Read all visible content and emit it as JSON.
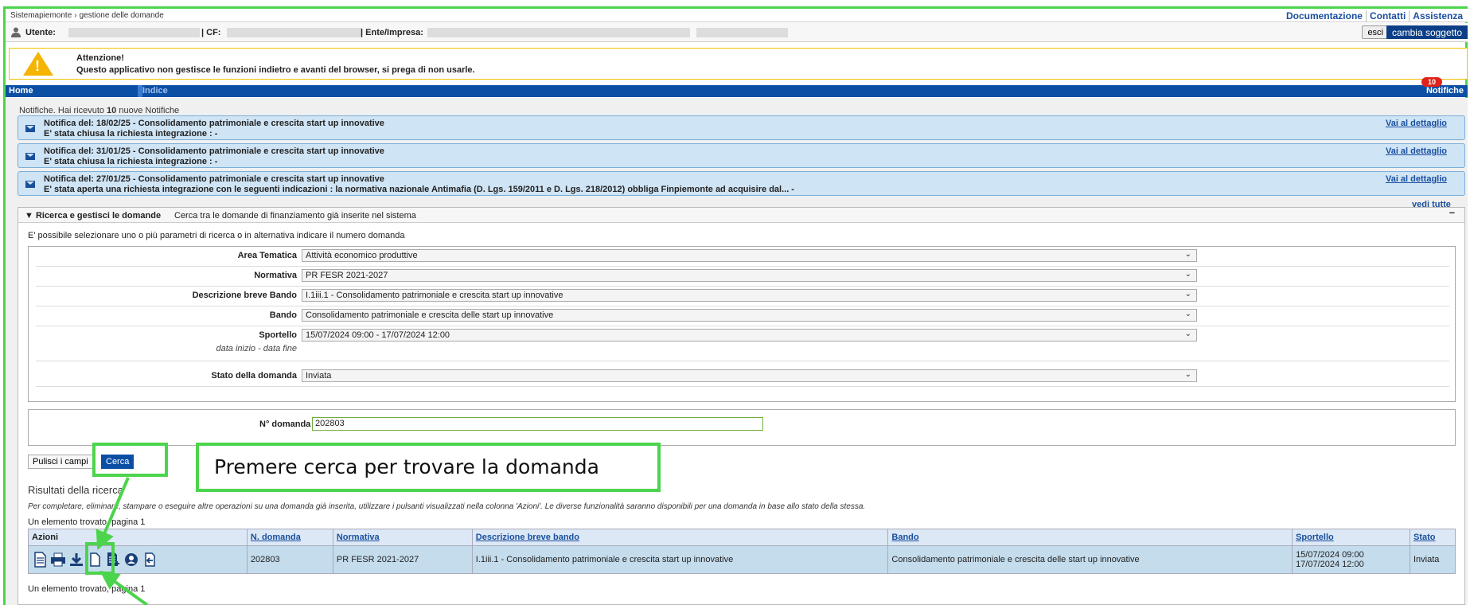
{
  "topbar": {
    "breadcrumb_root": "Sistemapiemonte",
    "breadcrumb_sep": "›",
    "breadcrumb_current": "gestione delle domande",
    "links": [
      "Documentazione",
      "Contatti",
      "Assistenza"
    ]
  },
  "userbar": {
    "utente_label": "Utente:",
    "cf_label": "| CF:",
    "ente_label": "| Ente/Impresa:",
    "esci": "esci",
    "cambia": "cambia soggetto"
  },
  "alert": {
    "title": "Attenzione!",
    "message": "Questo applicativo non gestisce le funzioni indietro e avanti del browser, si prega di non usarle."
  },
  "nav": {
    "home": "Home",
    "indice": "Indice",
    "notifiche": "Notifiche",
    "badge": "10"
  },
  "notifications": {
    "summary_prefix": "Notifiche. Hai ricevuto ",
    "summary_count": "10",
    "summary_suffix": " nuove Notifiche",
    "items": [
      {
        "line1": "Notifica del: 18/02/25 - Consolidamento patrimoniale e crescita start up innovative",
        "line2": "E' stata chiusa la richiesta integrazione : -",
        "link": "Vai al dettaglio"
      },
      {
        "line1": "Notifica del: 31/01/25 - Consolidamento patrimoniale e crescita start up innovative",
        "line2": "E' stata chiusa la richiesta integrazione : -",
        "link": "Vai al dettaglio"
      },
      {
        "line1": "Notifica del: 27/01/25 - Consolidamento patrimoniale e crescita start up innovative",
        "line2": "E' stata aperta una richiesta integrazione con le seguenti indicazioni : la normativa nazionale Antimafia (D. Lgs. 159/2011 e D. Lgs. 218/2012) obbliga Finpiemonte ad acquisire dal... -",
        "link": "Vai al dettaglio"
      }
    ],
    "vedi_tutte": "vedi tutte"
  },
  "search": {
    "panel_title": "▼ Ricerca e gestisci le domande",
    "panel_sub": "Cerca tra le domande di finanziamento già inserite nel sistema",
    "panel_min": "–",
    "intro": "E' possibile selezionare uno o più parametri di ricerca o in alternativa indicare il numero domanda",
    "fields": {
      "area": {
        "label": "Area Tematica",
        "value": "Attività economico produttive"
      },
      "normativa": {
        "label": "Normativa",
        "value": "PR FESR 2021-2027"
      },
      "descr": {
        "label": "Descrizione breve Bando",
        "value": "I.1iii.1 - Consolidamento patrimoniale e crescita start up innovative"
      },
      "bando": {
        "label": "Bando",
        "value": "Consolidamento patrimoniale e crescita delle start up innovative"
      },
      "sportello": {
        "label": "Sportello",
        "sublabel": "data inizio - data fine",
        "value": "15/07/2024 09:00 - 17/07/2024 12:00"
      },
      "stato": {
        "label": "Stato della domanda",
        "value": "Inviata"
      }
    },
    "numero_label": "N° domanda",
    "numero_value": "202803",
    "pulisci": "Pulisci i campi",
    "cerca": "Cerca"
  },
  "results": {
    "title": "Risultati della ricerca",
    "desc": "Per completare, eliminare, stampare o eseguire altre operazioni su una domanda già inserita, utilizzare i pulsanti visualizzati nella colonna 'Azioni'. Le diverse funzionalità saranno disponibili per una domanda in base allo stato della stessa.",
    "count": "Un elemento trovato, pagina 1",
    "columns": [
      "Azioni",
      "N. domanda",
      "Normativa",
      "Descrizione breve bando",
      "Bando",
      "Sportello",
      "Stato"
    ],
    "row": {
      "numero": "202803",
      "normativa": "PR FESR 2021-2027",
      "descr": "I.1iii.1 - Consolidamento patrimoniale e crescita start up innovative",
      "bando": "Consolidamento patrimoniale e crescita delle start up innovative",
      "sportello_start": "15/07/2024 09:00",
      "sportello_end": "17/07/2024 12:00",
      "stato": "Inviata"
    },
    "action_icons": [
      "document-icon",
      "print-icon",
      "download-icon",
      "blank-document-icon",
      "document-list-icon",
      "user-circle-icon",
      "exit-document-icon"
    ]
  },
  "annotation": {
    "callout": "Premere cerca per trovare la domanda",
    "color": "#4cd44c"
  }
}
